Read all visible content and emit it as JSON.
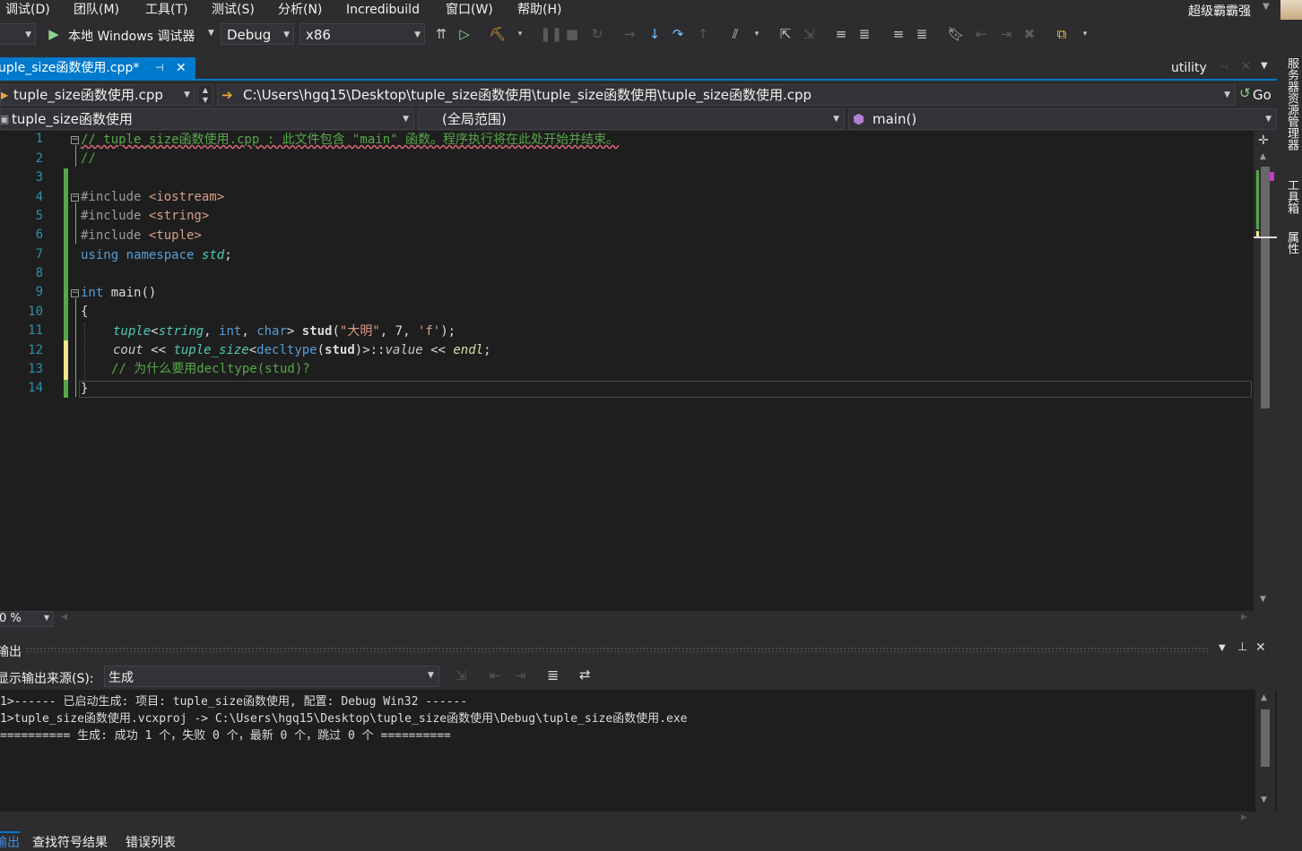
{
  "menu": [
    "调试(D)",
    "团队(M)",
    "工具(T)",
    "测试(S)",
    "分析(N)",
    "Incredibuild",
    "窗口(W)",
    "帮助(H)"
  ],
  "user": {
    "name": "超级霸霸强"
  },
  "toolbar": {
    "debugger_label": "本地 Windows 调试器",
    "config": "Debug",
    "platform": "x86"
  },
  "right_strip": {
    "items": [
      "服务器资源管理器",
      "工具箱",
      "属性"
    ]
  },
  "doc_tabs": {
    "active": "uple_size函数使用.cpp*",
    "secondary": "utility"
  },
  "nav1": {
    "file_combo": "tuple_size函数使用.cpp",
    "path": "C:\\Users\\hgq15\\Desktop\\tuple_size函数使用\\tuple_size函数使用\\tuple_size函数使用.cpp",
    "go_label": "Go"
  },
  "nav2": {
    "project": "tuple_size函数使用",
    "scope": "(全局范围)",
    "member": "main()"
  },
  "editor": {
    "line_numbers": [
      "1",
      "2",
      "3",
      "4",
      "5",
      "6",
      "7",
      "8",
      "9",
      "10",
      "11",
      "12",
      "13",
      "14"
    ],
    "l1": "// tuple_size函数使用.cpp : 此文件包含 \"main\" 函数。程序执行将在此处开始并结束。",
    "l2": "//",
    "l4_dir": "#include ",
    "l4_file": "<iostream>",
    "l5_dir": "#include ",
    "l5_file": "<string>",
    "l6_dir": "#include ",
    "l6_file": "<tuple>",
    "l7_using": "using",
    "l7_namespace": "namespace",
    "l7_std": "std",
    "l7_semi": ";",
    "l9_int": "int",
    "l9_main": " main()",
    "l10": "{",
    "l11_tuple": "tuple",
    "l11_lt": "<",
    "l11_string": "string",
    "l11_comma1": ", ",
    "l11_int": "int",
    "l11_comma2": ", ",
    "l11_char": "char",
    "l11_gt": "> ",
    "l11_var": "stud",
    "l11_open": "(",
    "l11_s1": "\"大明\"",
    "l11_c3": ", 7, ",
    "l11_s2": "'f'",
    "l11_close": ");",
    "l12_cout": "cout",
    "l12_op1": " << ",
    "l12_ts": "tuple_size",
    "l12_lt": "<",
    "l12_decl": "decltype",
    "l12_p1": "(",
    "l12_stud": "stud",
    "l12_p2": ")>::",
    "l12_value": "value",
    "l12_op2": " << ",
    "l12_endl": "endl",
    "l12_semi": ";",
    "l13": "// 为什么要用decltype(stud)?",
    "l14": "}"
  },
  "zoom": "0 %",
  "output": {
    "title": "输出",
    "source_label": "显示输出来源(S):",
    "source_value": "生成",
    "lines": [
      "1>------ 已启动生成: 项目: tuple_size函数使用, 配置: Debug Win32 ------",
      "1>tuple_size函数使用.vcxproj -> C:\\Users\\hgq15\\Desktop\\tuple_size函数使用\\Debug\\tuple_size函数使用.exe",
      "========== 生成: 成功 1 个，失败 0 个，最新 0 个，跳过 0 个 =========="
    ]
  },
  "bottom_tabs": [
    "输出",
    "查找符号结果",
    "错误列表"
  ]
}
